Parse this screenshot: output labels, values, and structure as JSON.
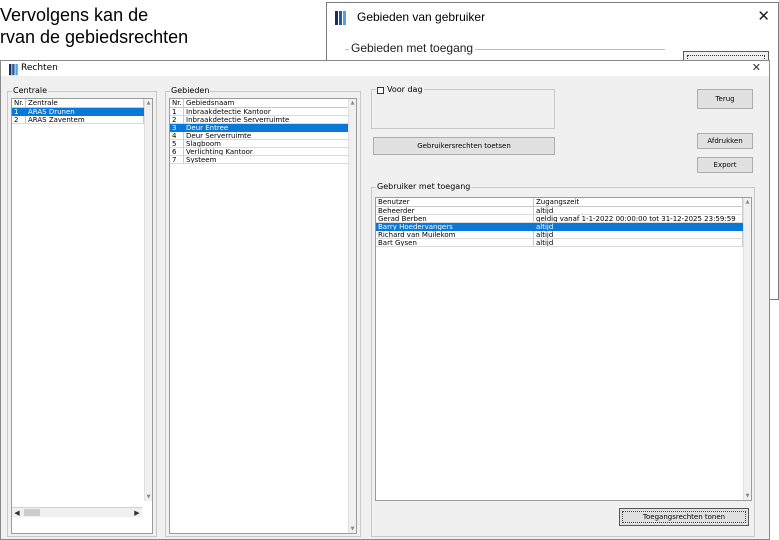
{
  "background": {
    "text_lines": [
      "Vervolgens kan de",
      "rvan de gebiedsrechten"
    ],
    "dialog": {
      "title": "Gebieden van gebruiker",
      "group_label": "Gebieden met toegang"
    }
  },
  "colors": {
    "selection": "#0a78d7",
    "icon_stripes": [
      "#1e2a5a",
      "#1d5a9e",
      "#4ea3e6"
    ]
  },
  "window": {
    "title": "Rechten",
    "centrale": {
      "label": "Centrale",
      "columns": [
        "Nr.",
        "Zentrale"
      ],
      "rows": [
        [
          "1",
          "ARAS Drunen"
        ],
        [
          "2",
          "ARAS Zaventem"
        ]
      ],
      "selected_index": 0
    },
    "gebieden": {
      "label": "Gebieden",
      "columns": [
        "Nr.",
        "Gebiedsnaam"
      ],
      "rows": [
        [
          "1",
          "Inbraakdetectie Kantoor"
        ],
        [
          "2",
          "Inbraakdetectie Serverruimte"
        ],
        [
          "3",
          "Deur Entree"
        ],
        [
          "4",
          "Deur Serverruimte"
        ],
        [
          "5",
          "Slagboom"
        ],
        [
          "6",
          "Verlichting Kantoor"
        ],
        [
          "7",
          "Systeem"
        ]
      ],
      "selected_index": 2
    },
    "voor_dag": {
      "label": "Voor dag",
      "checked": false
    },
    "check_button": "Gebruikersrechten toetsen",
    "buttons": {
      "terug": "Terug",
      "afdrukken": "Afdrukken",
      "export": "Export"
    },
    "users": {
      "label": "Gebruiker met toegang",
      "columns": [
        "Benutzer",
        "Zugangszeit"
      ],
      "rows": [
        [
          "Beheerder",
          "altijd"
        ],
        [
          "Gerad Berben",
          "geldig vanaf 1-1-2022 00:00:00 tot 31-12-2025 23:59:59"
        ],
        [
          "Barry Hoedervangers",
          "altijd"
        ],
        [
          "Richard van Muilekom",
          "altijd"
        ],
        [
          "Bart Gysen",
          "altijd"
        ]
      ],
      "selected_index": 2
    },
    "show_rights_button": "Toegangsrechten tonen"
  }
}
